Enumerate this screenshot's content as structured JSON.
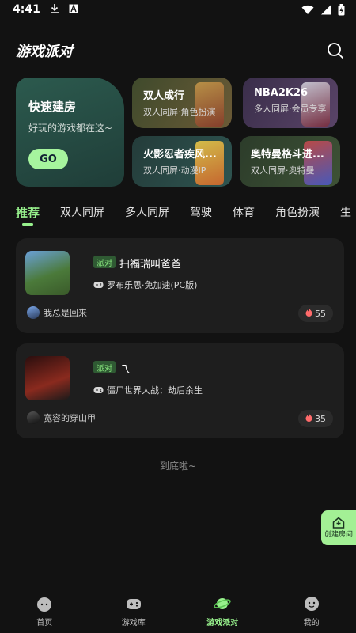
{
  "status_bar": {
    "time": "4:41",
    "download_icon": "download-icon",
    "a_icon": "A"
  },
  "header": {
    "title": "游戏派对",
    "search_icon": "search-icon"
  },
  "quick_start": {
    "title": "快速建房",
    "subtitle": "好玩的游戏都在这~",
    "go_label": "GO"
  },
  "featured_games": [
    {
      "name": "双人成行",
      "subtitle": "双人同屏·角色扮演",
      "color": "#5a5a3a"
    },
    {
      "name": "NBA2K26",
      "subtitle": "多人同屏·会员专享",
      "color": "#4a3a58"
    },
    {
      "name": "火影忍者疾风...",
      "subtitle": "双人同屏·动漫IP",
      "color": "#2e4a48"
    },
    {
      "name": "奥特曼格斗进...",
      "subtitle": "双人同屏·奥特曼",
      "color": "#3a4a38"
    }
  ],
  "tabs": [
    "推荐",
    "双人同屏",
    "多人同屏",
    "驾驶",
    "体育",
    "角色扮演",
    "生"
  ],
  "rooms": [
    {
      "tag": "派对",
      "title": "扫福瑞叫爸爸",
      "game": "罗布乐思·免加速(PC版)",
      "host": "我总是回来",
      "heat": "55",
      "thumb_color": "#4b7a3a"
    },
    {
      "tag": "派对",
      "title": "乁",
      "game": "僵尸世界大战：劫后余生",
      "host": "宽容的穿山甲",
      "heat": "35",
      "thumb_color": "#6a1e1e"
    }
  ],
  "end_text": "到底啦~",
  "create_room_label": "创建房间",
  "bottom_nav": [
    {
      "label": "首页",
      "icon": "home-icon"
    },
    {
      "label": "游戏库",
      "icon": "gamepad-icon"
    },
    {
      "label": "游戏派对",
      "icon": "planet-icon"
    },
    {
      "label": "我的",
      "icon": "profile-icon"
    }
  ],
  "colors": {
    "accent": "#97f08c",
    "background": "#121212",
    "card": "#1e1e1e"
  }
}
